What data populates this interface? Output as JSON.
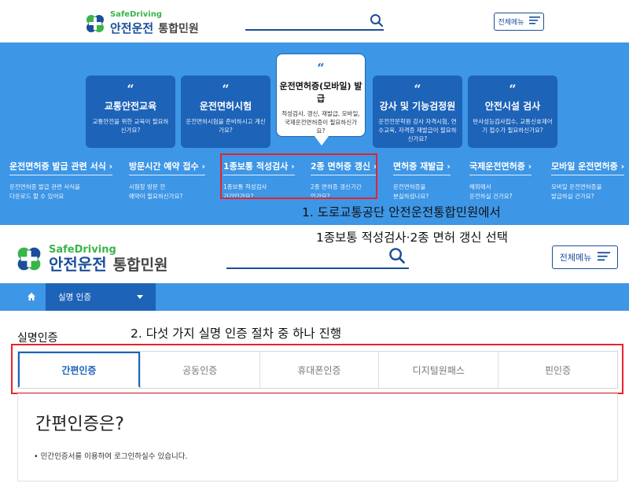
{
  "header_top": {
    "brand_en": "SafeDriving",
    "brand_ko": "안전운전",
    "brand_sub": "통합민원",
    "menu_label": "전체메뉴"
  },
  "hero": {
    "cards": [
      {
        "title": "교통안전교육",
        "desc": "교통안전을 위한 교육이 필요하신가요?"
      },
      {
        "title": "운전면허시험",
        "desc": "운전면허시험을 준비하시고 계신가요?"
      },
      {
        "title": "운전면허증(모바일) 발급",
        "desc": "적성검사, 갱신, 재발급, 모바일, 국제운전면허증이 필요하신가요?"
      },
      {
        "title": "강사 및 기능검정원",
        "desc": "운전전문학원 강사 자격시험, 연수교육, 자격증 재발급이 필요하신가요?"
      },
      {
        "title": "안전시설 검사",
        "desc": "반사성능검사접수, 교통신호제어기 접수가 필요하신가요?"
      }
    ],
    "services": [
      {
        "title": "운전면허증 발급 관련 서식",
        "desc_1": "운전면허증 발급 관련 서식을",
        "desc_2": "다운로드 할 수 있어요"
      },
      {
        "title": "방문시간 예약 접수",
        "desc_1": "시험장 방문 전",
        "desc_2": "예약이 필요하신가요?"
      },
      {
        "title": "1종보통 적성검사",
        "desc_1": "1종보통 적성검사",
        "desc_2": "기간인가요?"
      },
      {
        "title": "2종 면허증 갱신",
        "desc_1": "2종 면허증 갱신기간",
        "desc_2": "인가요?"
      },
      {
        "title": "면허증 재발급",
        "desc_1": "운전면허증을",
        "desc_2": "분실하셨나요?"
      },
      {
        "title": "국제운전면허증",
        "desc_1": "해외에서",
        "desc_2": "운전하실 건가요?"
      },
      {
        "title": "모바일 운전면허증",
        "desc_1": "모바일 운전면허증을",
        "desc_2": "발급하실 건가요?"
      }
    ]
  },
  "annotations": {
    "step1_line1": "1. 도로교통공단 안전운전통합민원에서",
    "step1_line2": "1종보통 적성검사·2종 면허 갱신 선택",
    "step2": "2. 다섯 가지 실명 인증 절차 중 하나 진행"
  },
  "header_main": {
    "brand_en": "SafeDriving",
    "brand_ko": "안전운전",
    "brand_sub": "통합민원",
    "menu_label": "전체메뉴"
  },
  "navbar": {
    "crumb": "실명 인증"
  },
  "section_title": "실명인증",
  "tabs": [
    {
      "label": "간편인증",
      "active": true
    },
    {
      "label": "공동인증",
      "active": false
    },
    {
      "label": "휴대폰인증",
      "active": false
    },
    {
      "label": "디지털원패스",
      "active": false
    },
    {
      "label": "핀인증",
      "active": false
    }
  ],
  "panel": {
    "title": "간편인증은?",
    "desc": "민간인증서를 이용하여 로그인하실수 있습니다."
  },
  "colors": {
    "primary_blue": "#1d63b8",
    "hero_blue": "#3d96e6",
    "brand_green": "#39b54a",
    "highlight_red": "#e8232b"
  }
}
